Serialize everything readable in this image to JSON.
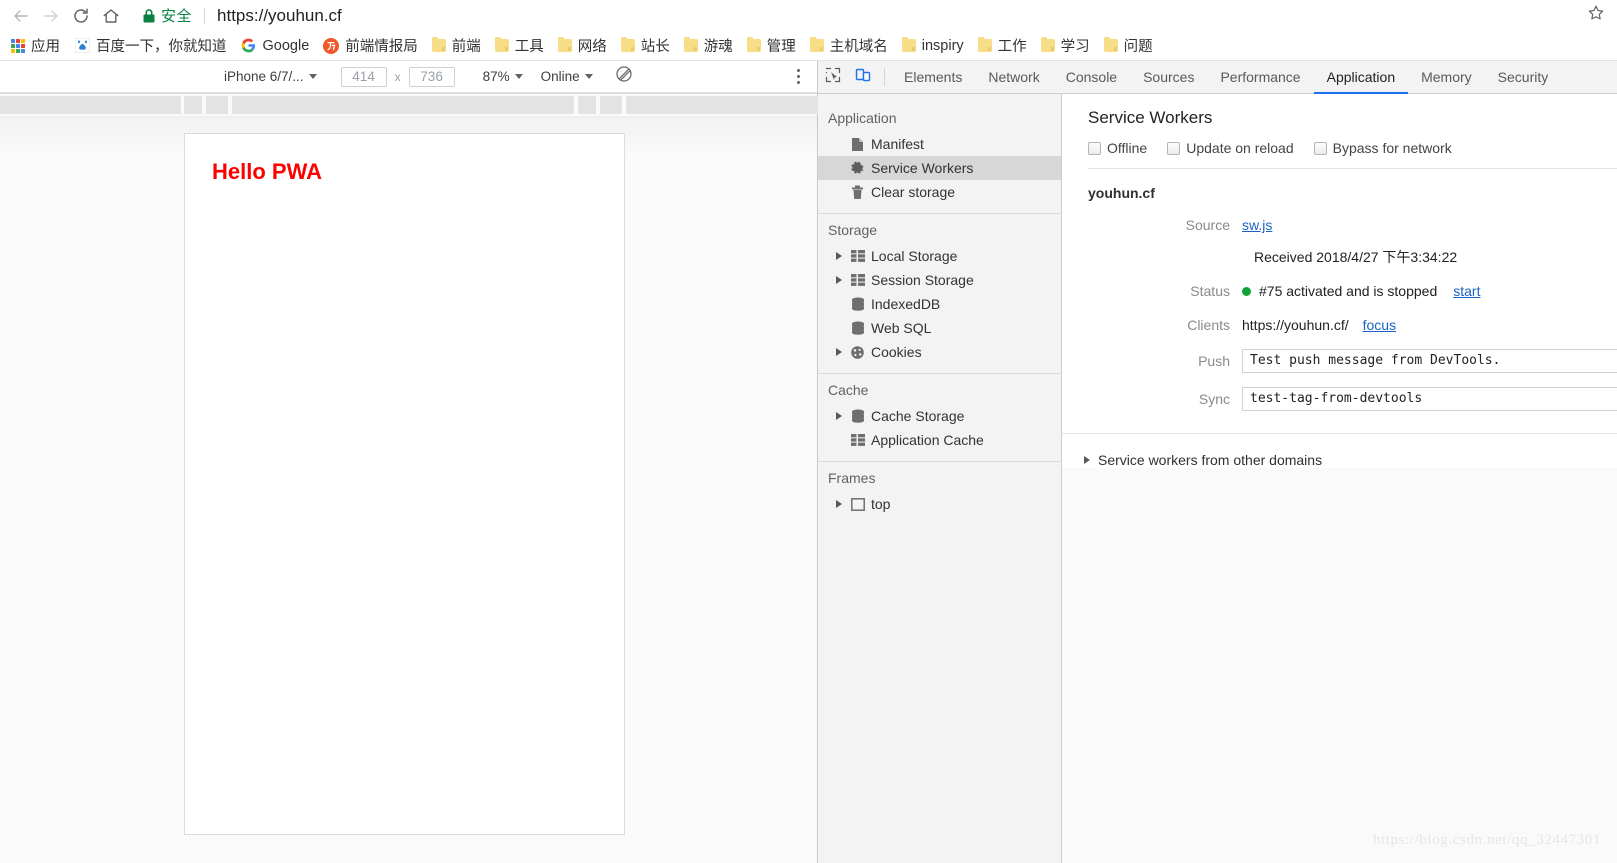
{
  "browser": {
    "nav": {
      "back_icon": "arrow-left-icon",
      "forward_icon": "arrow-right-icon",
      "reload_icon": "reload-icon",
      "home_icon": "home-icon",
      "star_icon": "star-icon"
    },
    "omnibox": {
      "lock_icon": "lock-icon",
      "secure_label": "安全",
      "url": "https://youhun.cf",
      "url_scheme": "https://",
      "url_host": "youhun.cf"
    },
    "bookmarks": {
      "apps_icon": "apps-grid-icon",
      "apps_label": "应用",
      "items": [
        {
          "label": "百度一下，你就知道",
          "icon": "baidu-favicon"
        },
        {
          "label": "Google",
          "icon": "google-favicon"
        },
        {
          "label": "前端情报局",
          "icon": "zhihu-favicon"
        },
        {
          "label": "前端",
          "icon": "folder-icon"
        },
        {
          "label": "工具",
          "icon": "folder-icon"
        },
        {
          "label": "网络",
          "icon": "folder-icon"
        },
        {
          "label": "站长",
          "icon": "folder-icon"
        },
        {
          "label": "游魂",
          "icon": "folder-icon"
        },
        {
          "label": "管理",
          "icon": "folder-icon"
        },
        {
          "label": "主机域名",
          "icon": "folder-icon"
        },
        {
          "label": "inspiry",
          "icon": "folder-icon"
        },
        {
          "label": "工作",
          "icon": "folder-icon"
        },
        {
          "label": "学习",
          "icon": "folder-icon"
        },
        {
          "label": "问题",
          "icon": "folder-icon"
        }
      ]
    }
  },
  "device_toolbar": {
    "device": "iPhone 6/7/...",
    "width": "414",
    "height": "736",
    "times": "x",
    "zoom": "87%",
    "throttling": "Online",
    "rotate_icon": "rotate-icon",
    "more_icon": "more-vertical-icon"
  },
  "page": {
    "heading": "Hello PWA",
    "heading_color": "#fe0000"
  },
  "devtools": {
    "inspect_icon": "inspect-cursor-icon",
    "device_toggle_icon": "device-toolbar-icon",
    "tabs": [
      {
        "label": "Elements",
        "active": false
      },
      {
        "label": "Network",
        "active": false
      },
      {
        "label": "Console",
        "active": false
      },
      {
        "label": "Sources",
        "active": false
      },
      {
        "label": "Performance",
        "active": false
      },
      {
        "label": "Application",
        "active": true
      },
      {
        "label": "Memory",
        "active": false
      },
      {
        "label": "Security",
        "active": false
      }
    ],
    "accent_color": "#1a73e8",
    "sidebar": {
      "groups": [
        {
          "title": "Application",
          "items": [
            {
              "label": "Manifest",
              "icon": "document-icon",
              "expandable": false,
              "selected": false
            },
            {
              "label": "Service Workers",
              "icon": "gear-icon",
              "expandable": false,
              "selected": true
            },
            {
              "label": "Clear storage",
              "icon": "trash-icon",
              "expandable": false,
              "selected": false
            }
          ]
        },
        {
          "title": "Storage",
          "items": [
            {
              "label": "Local Storage",
              "icon": "table-icon",
              "expandable": true,
              "selected": false
            },
            {
              "label": "Session Storage",
              "icon": "table-icon",
              "expandable": true,
              "selected": false
            },
            {
              "label": "IndexedDB",
              "icon": "database-icon",
              "expandable": false,
              "selected": false
            },
            {
              "label": "Web SQL",
              "icon": "database-icon",
              "expandable": false,
              "selected": false
            },
            {
              "label": "Cookies",
              "icon": "cookie-icon",
              "expandable": true,
              "selected": false
            }
          ]
        },
        {
          "title": "Cache",
          "items": [
            {
              "label": "Cache Storage",
              "icon": "database-icon",
              "expandable": true,
              "selected": false
            },
            {
              "label": "Application Cache",
              "icon": "table-icon",
              "expandable": false,
              "selected": false
            }
          ]
        },
        {
          "title": "Frames",
          "items": [
            {
              "label": "top",
              "icon": "frame-icon",
              "expandable": true,
              "selected": false
            }
          ]
        }
      ]
    },
    "service_workers": {
      "title": "Service Workers",
      "toggles": [
        {
          "label": "Offline",
          "checked": false
        },
        {
          "label": "Update on reload",
          "checked": false
        },
        {
          "label": "Bypass for network",
          "checked": false
        }
      ],
      "origin": "youhun.cf",
      "rows": {
        "source_label": "Source",
        "source_link": "sw.js",
        "received": "Received 2018/4/27 下午3:34:22",
        "status_label": "Status",
        "status_text": "#75 activated and is stopped",
        "status_color": "#12a23a",
        "status_action": "start",
        "clients_label": "Clients",
        "clients_value": "https://youhun.cf/",
        "clients_action": "focus",
        "push_label": "Push",
        "push_value": "Test push message from DevTools.",
        "sync_label": "Sync",
        "sync_value": "test-tag-from-devtools"
      },
      "other_domains": "Service workers from other domains"
    }
  },
  "watermark": "https://blog.csdn.net/qq_32447301"
}
